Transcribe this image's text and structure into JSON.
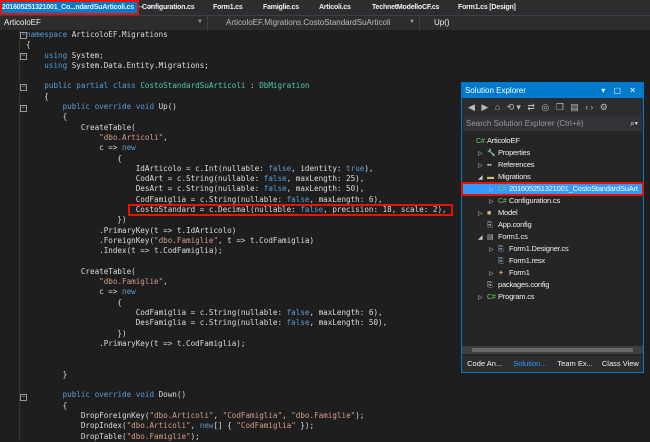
{
  "tabs": [
    {
      "label": "201605251321001_Co...ndardSuArticoli.cs",
      "active": true
    },
    {
      "label": "Configuration.cs"
    },
    {
      "label": "Form1.cs"
    },
    {
      "label": "Famiglie.cs"
    },
    {
      "label": "Articoli.cs"
    },
    {
      "label": "TechnetModelloCF.cs"
    },
    {
      "label": "Form1.cs [Design]"
    }
  ],
  "tab_pin": "⊸",
  "tab_close": "✕",
  "nav": {
    "project": "ArticoloEF",
    "type": "ArticoloEF.Migrations.CostoStandardSuArticoli",
    "member": "Up()"
  },
  "code": [
    [
      [
        "kw",
        "namespace"
      ],
      [
        "pl",
        " ArticoloEF.Migrations"
      ]
    ],
    [
      [
        "pl",
        "{"
      ]
    ],
    [
      [
        "pl",
        "    "
      ],
      [
        "kw",
        "using"
      ],
      [
        "pl",
        " System;"
      ]
    ],
    [
      [
        "pl",
        "    "
      ],
      [
        "kw",
        "using"
      ],
      [
        "pl",
        " System.Data.Entity.Migrations;"
      ]
    ],
    [],
    [
      [
        "pl",
        "    "
      ],
      [
        "kw",
        "public partial class"
      ],
      [
        "pl",
        " "
      ],
      [
        "ty",
        "CostoStandardSuArticoli"
      ],
      [
        "pl",
        " : "
      ],
      [
        "ty",
        "DbMigration"
      ]
    ],
    [
      [
        "pl",
        "    {"
      ]
    ],
    [
      [
        "pl",
        "        "
      ],
      [
        "kw",
        "public override void"
      ],
      [
        "pl",
        " Up()"
      ]
    ],
    [
      [
        "pl",
        "        {"
      ]
    ],
    [
      [
        "pl",
        "            CreateTable("
      ]
    ],
    [
      [
        "pl",
        "                "
      ],
      [
        "st",
        "\"dbo.Articoli\""
      ],
      [
        "pl",
        ","
      ]
    ],
    [
      [
        "pl",
        "                c => "
      ],
      [
        "kw",
        "new"
      ]
    ],
    [
      [
        "pl",
        "                    {"
      ]
    ],
    [
      [
        "pl",
        "                        IdArticolo = c.Int(nullable: "
      ],
      [
        "kw",
        "false"
      ],
      [
        "pl",
        ", identity: "
      ],
      [
        "kw",
        "true"
      ],
      [
        "pl",
        "),"
      ]
    ],
    [
      [
        "pl",
        "                        CodArt = c.String(nullable: "
      ],
      [
        "kw",
        "false"
      ],
      [
        "pl",
        ", maxLength: 25),"
      ]
    ],
    [
      [
        "pl",
        "                        DesArt = c.String(nullable: "
      ],
      [
        "kw",
        "false"
      ],
      [
        "pl",
        ", maxLength: 50),"
      ]
    ],
    [
      [
        "pl",
        "                        CodFamiglia = c.String(nullable: "
      ],
      [
        "kw",
        "false"
      ],
      [
        "pl",
        ", maxLength: 6),"
      ]
    ],
    [
      [
        "pl",
        "                        CostoStandard = c.Decimal(nullable: "
      ],
      [
        "kw",
        "false"
      ],
      [
        "pl",
        ", precision: 18, scale: 2),"
      ]
    ],
    [
      [
        "pl",
        "                    })"
      ]
    ],
    [
      [
        "pl",
        "                .PrimaryKey(t => t.IdArticolo)"
      ]
    ],
    [
      [
        "pl",
        "                .ForeignKey("
      ],
      [
        "st",
        "\"dbo.Famiglie\""
      ],
      [
        "pl",
        ", t => t.CodFamiglia)"
      ]
    ],
    [
      [
        "pl",
        "                .Index(t => t.CodFamiglia);"
      ]
    ],
    [],
    [
      [
        "pl",
        "            CreateTable("
      ]
    ],
    [
      [
        "pl",
        "                "
      ],
      [
        "st",
        "\"dbo.Famiglie\""
      ],
      [
        "pl",
        ","
      ]
    ],
    [
      [
        "pl",
        "                c => "
      ],
      [
        "kw",
        "new"
      ]
    ],
    [
      [
        "pl",
        "                    {"
      ]
    ],
    [
      [
        "pl",
        "                        CodFamiglia = c.String(nullable: "
      ],
      [
        "kw",
        "false"
      ],
      [
        "pl",
        ", maxLength: 6),"
      ]
    ],
    [
      [
        "pl",
        "                        DesFamiglia = c.String(nullable: "
      ],
      [
        "kw",
        "false"
      ],
      [
        "pl",
        ", maxLength: 50),"
      ]
    ],
    [
      [
        "pl",
        "                    })"
      ]
    ],
    [
      [
        "pl",
        "                .PrimaryKey(t => t.CodFamiglia);"
      ]
    ],
    [],
    [],
    [
      [
        "pl",
        "        }"
      ]
    ],
    [],
    [
      [
        "pl",
        "        "
      ],
      [
        "kw",
        "public override void"
      ],
      [
        "pl",
        " Down()"
      ]
    ],
    [
      [
        "pl",
        "        {"
      ]
    ],
    [
      [
        "pl",
        "            DropForeignKey("
      ],
      [
        "st",
        "\"dbo.Articoli\""
      ],
      [
        "pl",
        ", "
      ],
      [
        "st",
        "\"CodFamiglia\""
      ],
      [
        "pl",
        ", "
      ],
      [
        "st",
        "\"dbo.Famiglie\""
      ],
      [
        "pl",
        ");"
      ]
    ],
    [
      [
        "pl",
        "            DropIndex("
      ],
      [
        "st",
        "\"dbo.Articoli\""
      ],
      [
        "pl",
        ", "
      ],
      [
        "kw",
        "new"
      ],
      [
        "pl",
        "[] { "
      ],
      [
        "st",
        "\"CodFamiglia\""
      ],
      [
        "pl",
        " });"
      ]
    ],
    [
      [
        "pl",
        "            DropTable("
      ],
      [
        "st",
        "\"dbo.Famiglie\""
      ],
      [
        "pl",
        ");"
      ]
    ]
  ],
  "solution_explorer": {
    "title": "Solution Explorer",
    "title_buttons": "▾ ▢ ✕",
    "toolbar": "◀ ▶ ⌂ ⟲▾ ⇄ ◎ ❐ ▤ ‹› ⚙",
    "search_placeholder": "Search Solution Explorer (Ctrl+è)",
    "search_icon": "⌕▾",
    "items": [
      {
        "label": "ArticoloEF",
        "depth": 0,
        "arrow": "",
        "icon": "C#",
        "icon_name": "csharp-project-icon",
        "color": "#6c6"
      },
      {
        "label": "Properties",
        "depth": 1,
        "arrow": "▷",
        "icon": "🔧",
        "icon_name": "wrench-icon",
        "color": "#ccc"
      },
      {
        "label": "References",
        "depth": 1,
        "arrow": "▷",
        "icon": "▪▪",
        "icon_name": "references-icon",
        "color": "#ccc"
      },
      {
        "label": "Migrations",
        "depth": 1,
        "arrow": "◢",
        "icon": "▬",
        "icon_name": "folder-open-icon",
        "color": "#dcb67a"
      },
      {
        "label": "201605251321001_CostoStandardSuArt",
        "depth": 2,
        "arrow": "▷",
        "icon": "C#",
        "icon_name": "csharp-file-icon",
        "color": "#6c6",
        "selected": true
      },
      {
        "label": "Configuration.cs",
        "depth": 2,
        "arrow": "▷",
        "icon": "C#",
        "icon_name": "csharp-file-icon",
        "color": "#6c6"
      },
      {
        "label": "Model",
        "depth": 1,
        "arrow": "▷",
        "icon": "■",
        "icon_name": "folder-icon",
        "color": "#dcb67a"
      },
      {
        "label": "App.config",
        "depth": 1,
        "arrow": "",
        "icon": "⎘",
        "icon_name": "config-file-icon",
        "color": "#ccc"
      },
      {
        "label": "Form1.cs",
        "depth": 1,
        "arrow": "◢",
        "icon": "▤",
        "icon_name": "form-icon",
        "color": "#ccc"
      },
      {
        "label": "Form1.Designer.cs",
        "depth": 2,
        "arrow": "▷",
        "icon": "⎘",
        "icon_name": "designer-file-icon",
        "color": "#9cf"
      },
      {
        "label": "Form1.resx",
        "depth": 2,
        "arrow": "",
        "icon": "⎘",
        "icon_name": "resx-file-icon",
        "color": "#9cf"
      },
      {
        "label": "Form1",
        "depth": 2,
        "arrow": "▷",
        "icon": "✦",
        "icon_name": "class-icon",
        "color": "#e8a33d"
      },
      {
        "label": "packages.config",
        "depth": 1,
        "arrow": "",
        "icon": "⎘",
        "icon_name": "config-file-icon",
        "color": "#ccc"
      },
      {
        "label": "Program.cs",
        "depth": 1,
        "arrow": "▷",
        "icon": "C#",
        "icon_name": "csharp-file-icon",
        "color": "#6c6"
      }
    ],
    "bottom_tabs": [
      {
        "label": "Code An..."
      },
      {
        "label": "Solution...",
        "active": true
      },
      {
        "label": "Team Ex..."
      },
      {
        "label": "Class View"
      }
    ]
  }
}
